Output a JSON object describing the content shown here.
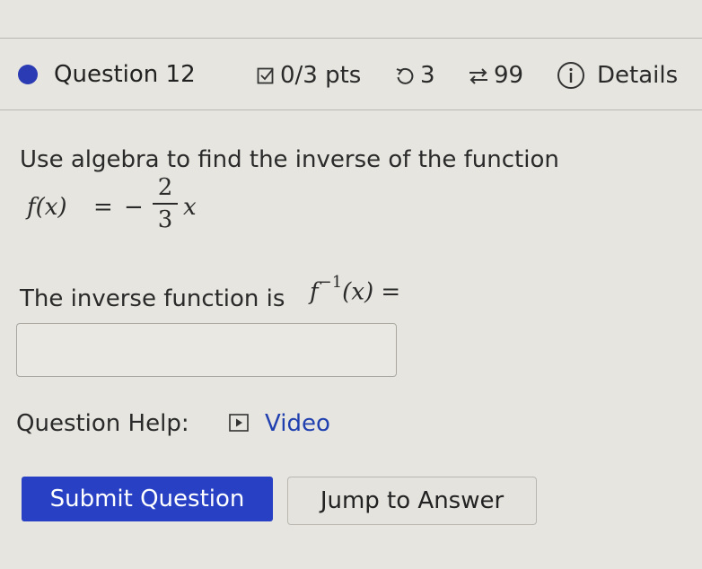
{
  "question": {
    "title": "Question 12",
    "points": "0/3 pts",
    "retries": "3",
    "submissions": "99",
    "details_label": "Details"
  },
  "body": {
    "prompt": "Use algebra to find the inverse of the function",
    "function": {
      "lhs": "f(x)",
      "equals": "=",
      "sign": "−",
      "numerator": "2",
      "denominator": "3",
      "variable": "x"
    },
    "inverse_label": "The inverse function is",
    "inverse_expr": {
      "f": "f",
      "exponent": "−1",
      "arg": "(x)",
      "equals": "="
    },
    "answer_value": ""
  },
  "help": {
    "label": "Question Help:",
    "video_label": "Video"
  },
  "buttons": {
    "submit_label": "Submit Question",
    "jump_label": "Jump to Answer"
  },
  "colors": {
    "accent": "#2740c4",
    "link": "#2040b0",
    "background": "#e6e5df"
  }
}
